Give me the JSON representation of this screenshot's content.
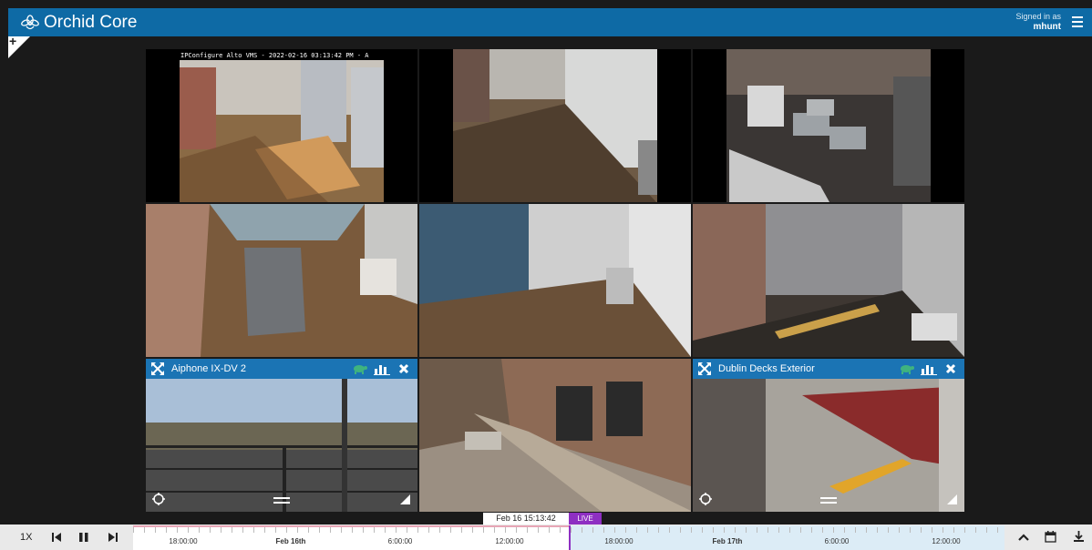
{
  "header": {
    "title": "Orchid Core",
    "signed_in_label": "Signed in as",
    "username": "mhunt"
  },
  "corner": {
    "add_label": "+"
  },
  "tiles": [
    {
      "stamp": "IPConfigure Alto VMS - 2022-02-16 03:13:42 PM - A"
    },
    {},
    {},
    {},
    {},
    {},
    {
      "name": "Aiphone IX-DV 2"
    },
    {},
    {
      "name": "Dublin Decks Exterior"
    }
  ],
  "timeline": {
    "current_time": "Feb 16 15:13:42",
    "live_label": "LIVE",
    "speed": "1X",
    "labels": [
      "18:00:00",
      "Feb 16th",
      "6:00:00",
      "12:00:00",
      "18:00:00",
      "Feb 17th",
      "6:00:00",
      "12:00:00"
    ]
  },
  "icons": {
    "logo": "orchid-logo-icon",
    "menu": "hamburger-menu-icon",
    "expand": "expand-arrows-icon",
    "turtle": "turtle-icon",
    "chart": "bar-chart-icon",
    "close": "close-icon",
    "ptz": "ptz-icon",
    "resize": "resize-corner-icon",
    "skip_back": "skip-back-icon",
    "pause": "pause-icon",
    "skip_fwd": "skip-forward-icon",
    "up": "chevron-up-icon",
    "calendar": "calendar-icon",
    "download": "download-icon"
  },
  "colors": {
    "header": "#0e6aa5",
    "tile_bar": "#1b74b4",
    "live": "#8e2fc2",
    "turtle": "#3fb37f"
  }
}
